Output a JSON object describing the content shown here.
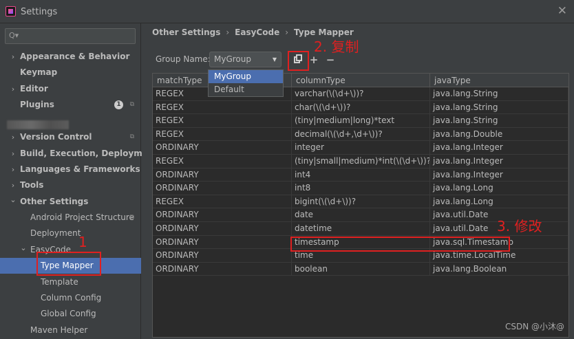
{
  "window": {
    "title": "Settings"
  },
  "search": {
    "placeholder": "Q▾"
  },
  "sidebar": {
    "items": [
      {
        "label": "Appearance & Behavior",
        "arrow": "›",
        "bold": true
      },
      {
        "label": "Keymap",
        "arrow": "",
        "bold": true
      },
      {
        "label": "Editor",
        "arrow": "›",
        "bold": true
      },
      {
        "label": "Plugins",
        "arrow": "",
        "bold": true,
        "badge": "1"
      },
      {
        "label": "Version Control",
        "arrow": "›",
        "bold": true
      },
      {
        "label": "Build, Execution, Deployment",
        "arrow": "›",
        "bold": true
      },
      {
        "label": "Languages & Frameworks",
        "arrow": "›",
        "bold": true
      },
      {
        "label": "Tools",
        "arrow": "›",
        "bold": true
      },
      {
        "label": "Other Settings",
        "arrow": "⌄",
        "bold": true
      },
      {
        "label": "Android Project Structure",
        "arrow": "",
        "bold": false
      },
      {
        "label": "Deployment",
        "arrow": "",
        "bold": false
      },
      {
        "label": "EasyCode",
        "arrow": "⌄",
        "bold": false
      },
      {
        "label": "Type Mapper",
        "arrow": "",
        "bold": false
      },
      {
        "label": "Template",
        "arrow": "",
        "bold": false
      },
      {
        "label": "Column Config",
        "arrow": "",
        "bold": false
      },
      {
        "label": "Global Config",
        "arrow": "",
        "bold": false
      },
      {
        "label": "Maven Helper",
        "arrow": "",
        "bold": false
      }
    ]
  },
  "breadcrumb": {
    "part1": "Other Settings",
    "part2": "EasyCode",
    "part3": "Type Mapper",
    "sep": "›"
  },
  "group": {
    "label": "Group Name:",
    "selected": "MyGroup",
    "options": [
      "MyGroup",
      "Default"
    ]
  },
  "toolbar": {
    "plus": "+",
    "minus": "−"
  },
  "table": {
    "headers": [
      "matchType",
      "columnType",
      "javaType"
    ],
    "rows": [
      [
        "REGEX",
        "varchar(\\(\\d+\\))?",
        "java.lang.String"
      ],
      [
        "REGEX",
        "char(\\(\\d+\\))?",
        "java.lang.String"
      ],
      [
        "REGEX",
        "(tiny|medium|long)*text",
        "java.lang.String"
      ],
      [
        "REGEX",
        "decimal(\\(\\d+,\\d+\\))?",
        "java.lang.Double"
      ],
      [
        "ORDINARY",
        "integer",
        "java.lang.Integer"
      ],
      [
        "REGEX",
        "(tiny|small|medium)*int(\\(\\d+\\))?",
        "java.lang.Integer"
      ],
      [
        "ORDINARY",
        "int4",
        "java.lang.Integer"
      ],
      [
        "ORDINARY",
        "int8",
        "java.lang.Long"
      ],
      [
        "REGEX",
        "bigint(\\(\\d+\\))?",
        "java.lang.Long"
      ],
      [
        "ORDINARY",
        "date",
        "java.util.Date"
      ],
      [
        "ORDINARY",
        "datetime",
        "java.util.Date"
      ],
      [
        "ORDINARY",
        "timestamp",
        "java.sql.Timestamp"
      ],
      [
        "ORDINARY",
        "time",
        "java.time.LocalTime"
      ],
      [
        "ORDINARY",
        "boolean",
        "java.lang.Boolean"
      ]
    ]
  },
  "annotations": {
    "step1": "1",
    "step2": "2. 复制",
    "step3": "3. 修改"
  },
  "watermark": "CSDN @小沐@",
  "colors": {
    "selection": "#4b6eaf",
    "annotation": "#e02020",
    "background": "#3c3f41"
  }
}
